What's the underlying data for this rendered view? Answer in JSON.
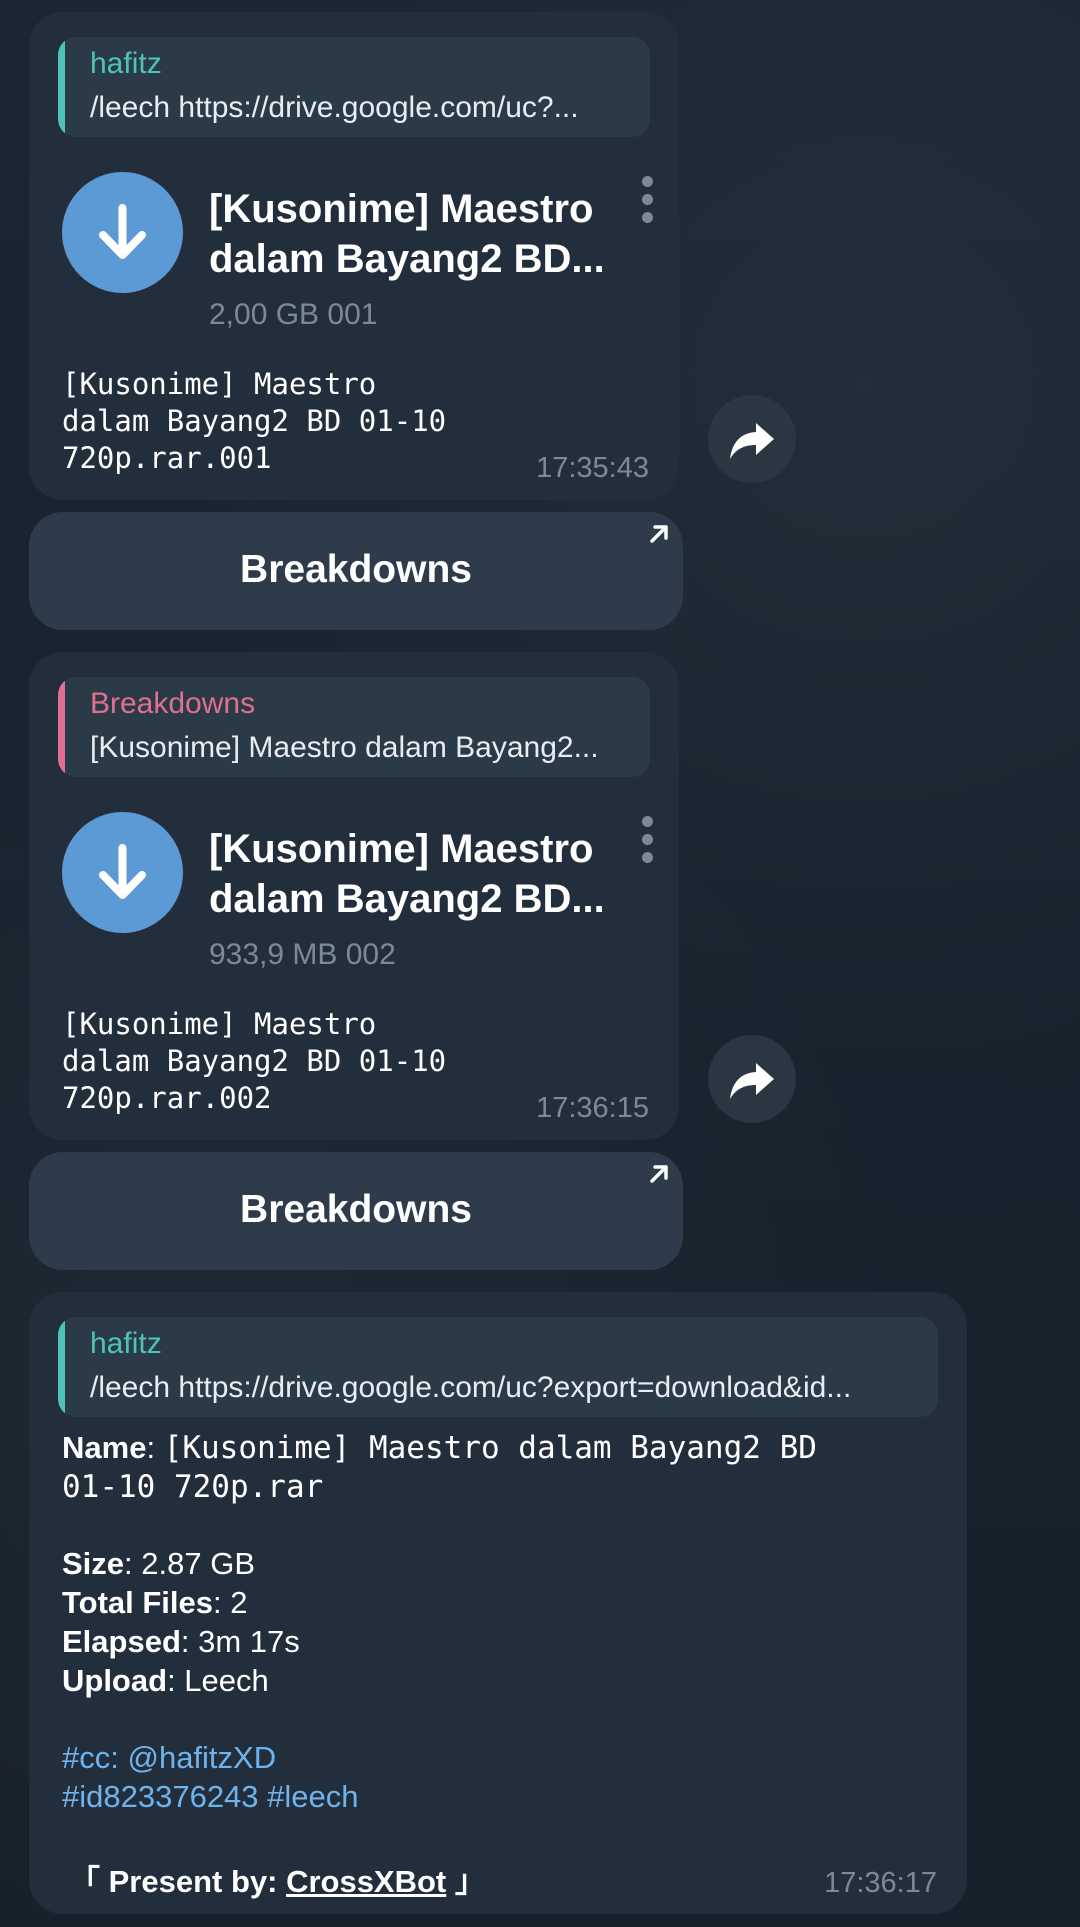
{
  "messages": [
    {
      "reply_author": "hafitz",
      "reply_text": "/leech https://drive.google.com/uc?...",
      "file_title": "[Kusonime] Maestro dalam Bayang2 BD...",
      "file_meta": "2,00 GB 001",
      "caption": "[Kusonime] Maestro\ndalam Bayang2 BD 01-10\n720p.rar.001",
      "time": "17:35:43",
      "button_label": "Breakdowns"
    },
    {
      "reply_author": "Breakdowns",
      "reply_text": "[Kusonime] Maestro dalam Bayang2...",
      "file_title": "[Kusonime] Maestro dalam Bayang2 BD...",
      "file_meta": "933,9 MB 002",
      "caption": "[Kusonime] Maestro\ndalam Bayang2 BD 01-10\n720p.rar.002",
      "time": "17:36:15",
      "button_label": "Breakdowns"
    }
  ],
  "summary": {
    "reply_author": "hafitz",
    "reply_text": "/leech https://drive.google.com/uc?export=download&id...",
    "name_label": "Name",
    "name_value_line1": "[Kusonime] Maestro dalam Bayang2 BD",
    "name_value_line2": "01-10 720p.rar",
    "size_label": "Size",
    "size_value": "2.87 GB",
    "files_label": "Total Files",
    "files_value": "2",
    "elapsed_label": "Elapsed",
    "elapsed_value": "3m 17s",
    "upload_label": "Upload",
    "upload_value": "Leech",
    "cc_tag": "#cc",
    "cc_user": "@hafitzXD",
    "id_tag": "#id823376243",
    "leech_tag": "#leech",
    "present_prefix": "「 Present by: ",
    "present_link": "CrossXBot",
    "present_suffix": " 」",
    "time": "17:36:17"
  },
  "colors": {
    "author_teal": "#4fc3b8",
    "author_pink": "#e0708f",
    "link_blue": "#6fb3ec",
    "bubble": "#232e3c",
    "button": "#2d3b4b",
    "download_circle": "#5c9ad6"
  },
  "icons": [
    "download-arrow-icon",
    "more-vertical-icon",
    "forward-icon",
    "open-external-icon"
  ]
}
